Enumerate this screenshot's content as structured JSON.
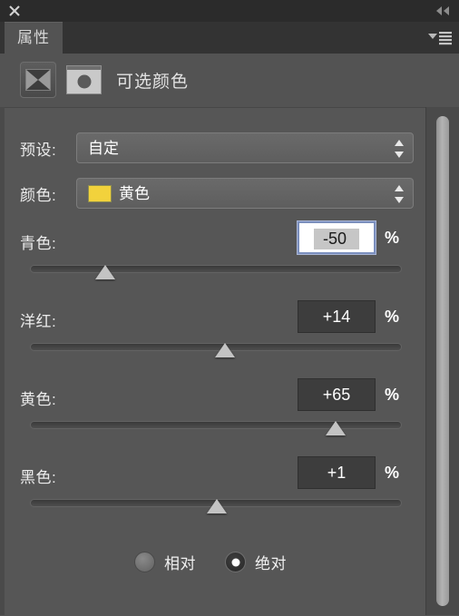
{
  "titlebar": {
    "close_icon": "close-icon",
    "collapse_icon": "collapse-double-left-icon"
  },
  "tabbar": {
    "active_tab": "属性",
    "menu_icon": "panel-menu-icon"
  },
  "adjustment": {
    "title": "可选颜色",
    "layer_icon": "selective-color-icon",
    "mask_icon": "layer-mask-thumbnail"
  },
  "preset": {
    "label": "预设:",
    "value": "自定"
  },
  "color": {
    "label": "颜色:",
    "value": "黄色",
    "swatch_hex": "#F2D23C"
  },
  "sliders": [
    {
      "label": "青色:",
      "value": "-50",
      "unit": "%",
      "percent": 25,
      "focused": true
    },
    {
      "label": "洋红:",
      "value": "+14",
      "unit": "%",
      "percent": 57,
      "focused": false
    },
    {
      "label": "黄色:",
      "value": "+65",
      "unit": "%",
      "percent": 82,
      "focused": false
    },
    {
      "label": "黑色:",
      "value": "+1",
      "unit": "%",
      "percent": 50,
      "focused": false
    }
  ],
  "method": {
    "relative_label": "相对",
    "absolute_label": "绝对",
    "selected": "绝对"
  },
  "colors": {
    "panel_bg": "#565656",
    "header_bg": "#535353",
    "titlebar_bg": "#2b2b2b",
    "tabbar_bg": "#333333",
    "text": "#ececec",
    "focus_border": "#7b8fbe"
  }
}
